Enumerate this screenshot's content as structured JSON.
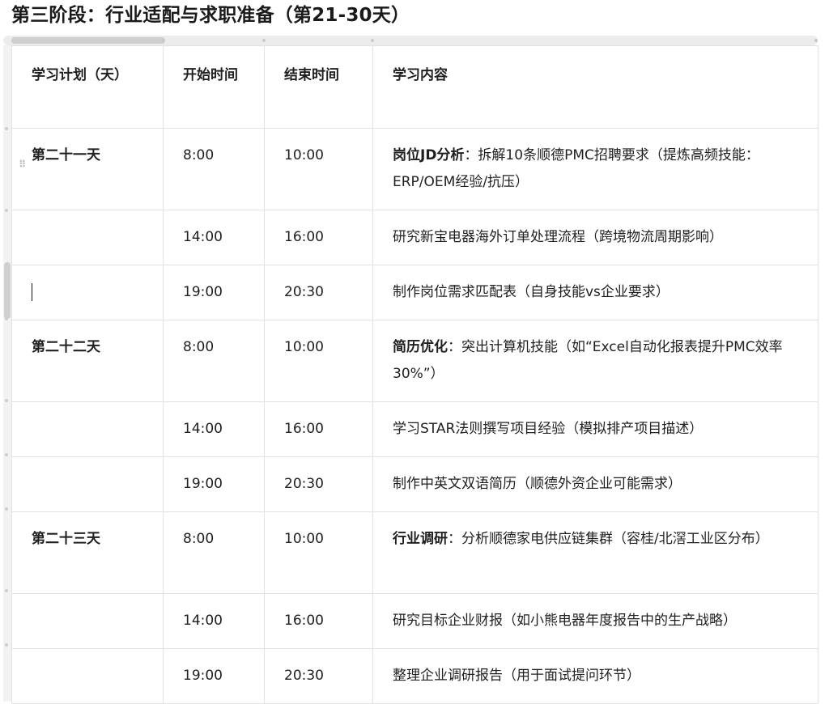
{
  "title": "第三阶段：行业适配与求职准备（第21-30天）",
  "table": {
    "headers": [
      "学习计划（天）",
      "开始时间",
      "结束时间",
      "学习内容"
    ],
    "rows": [
      {
        "day": "第二十一天",
        "start": "8:00",
        "end": "10:00",
        "keyword": "岗位JD分析",
        "content": "：拆解10条顺德PMC招聘要求（提炼高频技能：ERP/OEM经验/抗压）"
      },
      {
        "day": "",
        "start": "14:00",
        "end": "16:00",
        "keyword": "",
        "content": "研究新宝电器海外订单处理流程（跨境物流周期影响）"
      },
      {
        "day": "",
        "start": "19:00",
        "end": "20:30",
        "keyword": "",
        "content": "制作岗位需求匹配表（自身技能vs企业要求）"
      },
      {
        "day": "第二十二天",
        "start": "8:00",
        "end": "10:00",
        "keyword": "简历优化",
        "content": "：突出计算机技能（如“Excel自动化报表提升PMC效率30%”）"
      },
      {
        "day": "",
        "start": "14:00",
        "end": "16:00",
        "keyword": "",
        "content": "学习STAR法则撰写项目经验（模拟排产项目描述）"
      },
      {
        "day": "",
        "start": "19:00",
        "end": "20:30",
        "keyword": "",
        "content": "制作中英文双语简历（顺德外资企业可能需求）"
      },
      {
        "day": "第二十三天",
        "start": "8:00",
        "end": "10:00",
        "keyword": "行业调研",
        "content": "：分析顺德家电供应链集群（容桂/北滘工业区分布）"
      },
      {
        "day": "",
        "start": "14:00",
        "end": "16:00",
        "keyword": "",
        "content": "研究目标企业财报（如小熊电器年度报告中的生产战略）"
      },
      {
        "day": "",
        "start": "19:00",
        "end": "20:30",
        "keyword": "",
        "content": "整理企业调研报告（用于面试提问环节）"
      }
    ]
  }
}
